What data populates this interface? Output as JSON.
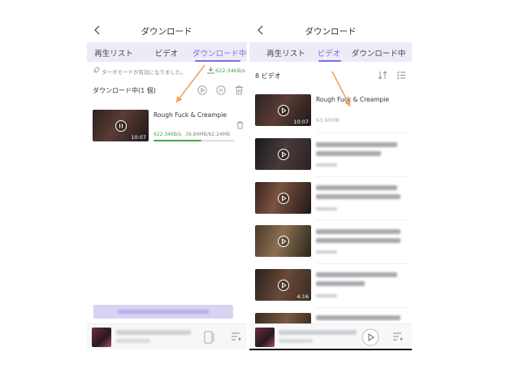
{
  "colors": {
    "accent": "#7b6fe0",
    "speed_green": "#47a84e",
    "tabbar_bg": "#ecebf8",
    "arrow_orange": "#f0a35a"
  },
  "left_panel": {
    "header": {
      "title": "ダウンロード",
      "back_icon": "chevron-left-icon"
    },
    "tabs": [
      {
        "label": "再生リスト"
      },
      {
        "label": "ビデオ"
      },
      {
        "label": "ダウンロード中",
        "active": true
      }
    ],
    "turbo": {
      "message": "ターボモードが有効になりました。",
      "speed": "622.34KB/s"
    },
    "section_title": "ダウンロード中(1 個)",
    "item": {
      "title": "Rough Fuck & Creampie",
      "duration": "10:07",
      "speed": "622.34KB/s",
      "size": "36.84MB/62.24MB",
      "progress": 0.59
    }
  },
  "right_panel": {
    "header": {
      "title": "ダウンロード",
      "back_icon": "chevron-left-icon"
    },
    "tabs": [
      {
        "label": "再生リスト"
      },
      {
        "label": "ビデオ",
        "active": true
      },
      {
        "label": "ダウンロード中"
      }
    ],
    "count_label": "8 ビデオ",
    "videos": [
      {
        "title": "Rough Fuck & Creampie",
        "size": "63.95MB",
        "duration": "10:07"
      },
      {
        "duration": ""
      },
      {
        "duration": ""
      },
      {
        "duration": ""
      },
      {
        "duration": "4:16"
      }
    ]
  }
}
